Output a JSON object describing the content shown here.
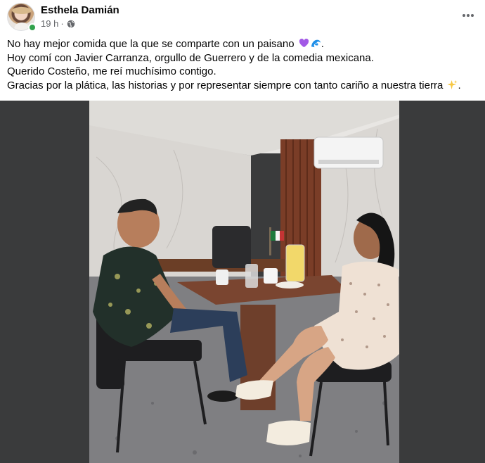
{
  "post": {
    "author": "Esthela Damián",
    "time": "19 h",
    "dot": "·",
    "lines": [
      "No hay mejor comida que la que se comparte con un paisano",
      "Hoy comí con  Javier Carranza, orgullo de Guerrero y de la comedia mexicana.",
      "Querido Costeño, me reí muchísimo contigo.",
      "Gracias por la plática, las historias y por representar siempre con tanto cariño a nuestra tierra"
    ],
    "line1_end": ".",
    "line4_end": ".",
    "emojis": [
      "purple-heart-icon",
      "water-wave-icon",
      "sparkles-icon"
    ]
  },
  "colors": {
    "online": "#31a24c",
    "meta_text": "#65676b",
    "photo_backdrop": "#3a3b3c"
  }
}
